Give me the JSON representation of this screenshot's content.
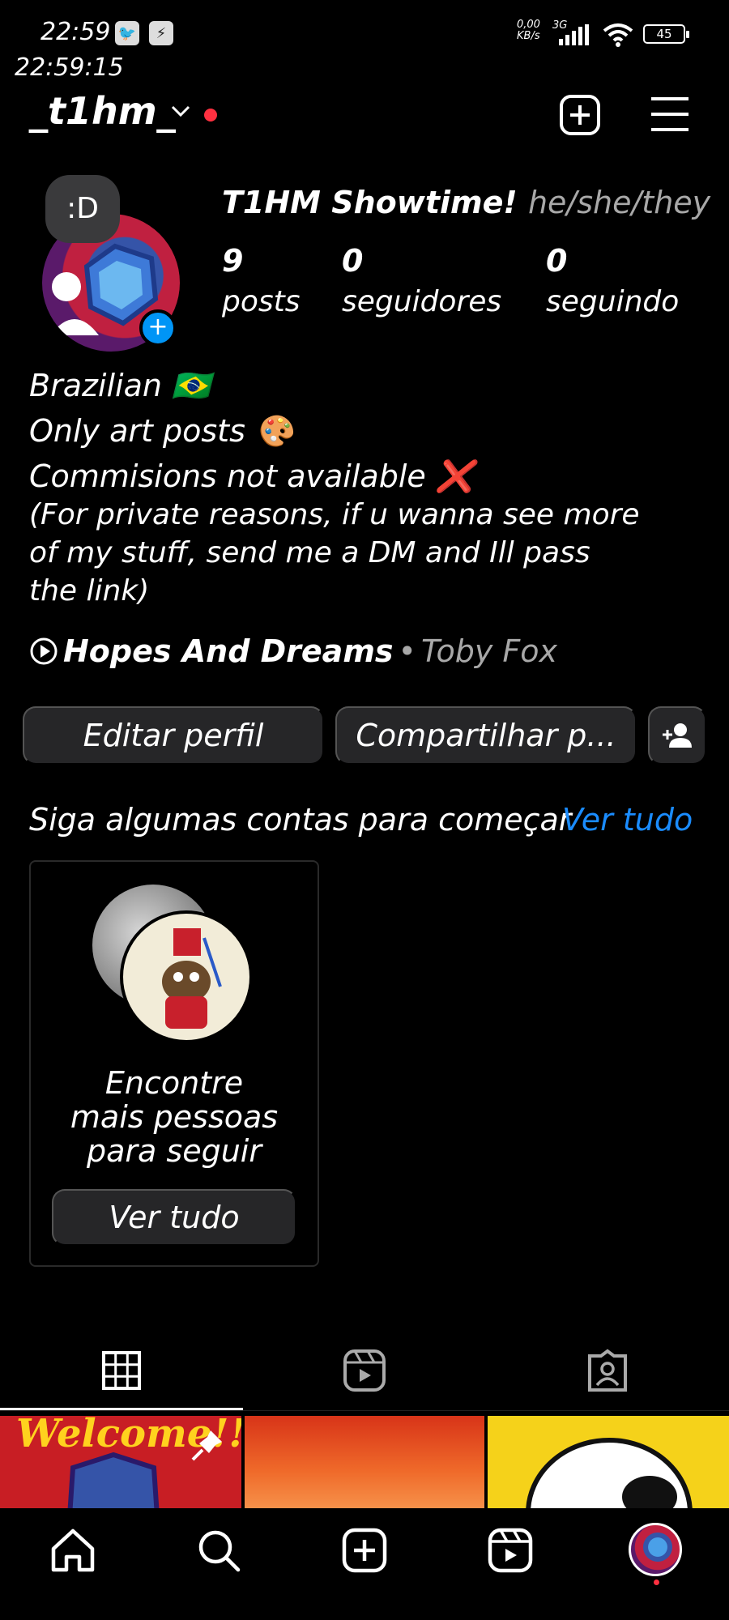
{
  "status_bar": {
    "time": "22:59",
    "overlay_clock": "22:59:15",
    "net_speed": "0,00",
    "net_unit": "KB/s",
    "network_type": "3G",
    "battery": "45",
    "icons": [
      "signal-icon",
      "wifi-icon",
      "battery-icon"
    ]
  },
  "header": {
    "username": "_t1hm_",
    "icons": [
      "chevron-down-icon",
      "new-post-icon",
      "menu-icon"
    ]
  },
  "profile": {
    "note": ":D",
    "display_name": "T1HM Showtime!",
    "pronouns": "he/she/they",
    "stats": [
      {
        "value": "9",
        "label": "posts"
      },
      {
        "value": "0",
        "label": "seguidores"
      },
      {
        "value": "0",
        "label": "seguindo"
      }
    ]
  },
  "bio": {
    "line1": "Brazilian 🇧🇷",
    "line2": "Only art posts 🎨",
    "line3": "Commisions not available ❌",
    "line4": "(For private reasons, if u wanna see more",
    "line5": "of my stuff, send me a DM and Ill pass",
    "line6": "the link)"
  },
  "music": {
    "title": "Hopes And Dreams",
    "separator": "•",
    "artist": "Toby Fox"
  },
  "actions": {
    "edit_profile": "Editar perfil",
    "share_profile": "Compartilhar p..."
  },
  "suggestions": {
    "title": "Siga algumas contas para começar",
    "see_all": "Ver tudo",
    "card_line1": "Encontre",
    "card_line2": "mais pessoas",
    "card_line3": "para seguir",
    "card_button": "Ver tudo"
  },
  "grid_thumbs": [
    {
      "caption": "Welcome!!"
    },
    {
      "caption": ""
    },
    {
      "caption": ""
    }
  ],
  "colors": {
    "background": "#000000",
    "accent": "#1a8cff",
    "button_bg": "#262628",
    "notification": "#ff3040"
  }
}
